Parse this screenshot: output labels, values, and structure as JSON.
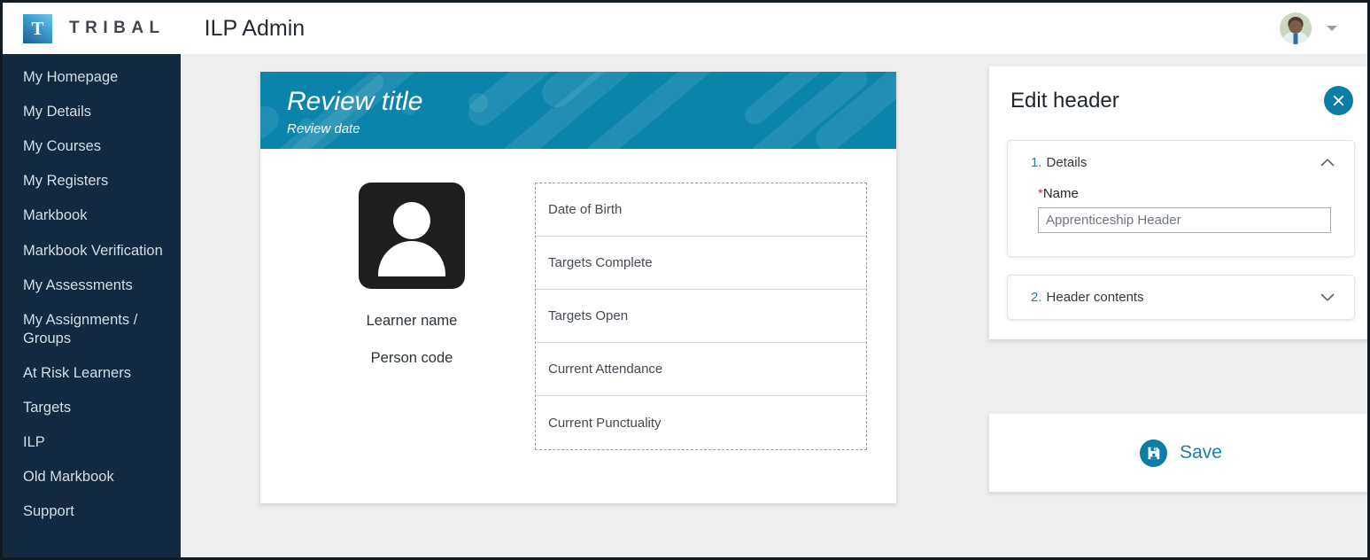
{
  "brand": {
    "logo_letter": "T",
    "logo_word": "TRIBAL",
    "app_title": "ILP Admin",
    "accent_color": "#0b7da6",
    "sidebar_color": "#13293f",
    "banner_color": "#0b84ac"
  },
  "topbar": {
    "avatar_name": "user-avatar",
    "caret_icon": "chevron-down-icon"
  },
  "sidebar": {
    "items": [
      {
        "label": "My Homepage"
      },
      {
        "label": "My Details"
      },
      {
        "label": "My Courses"
      },
      {
        "label": "My Registers"
      },
      {
        "label": "Markbook"
      },
      {
        "label": "Markbook Verification"
      },
      {
        "label": "My Assessments"
      },
      {
        "label": "My Assignments /\nGroups"
      },
      {
        "label": "At Risk Learners"
      },
      {
        "label": "Targets"
      },
      {
        "label": "ILP"
      },
      {
        "label": "Old Markbook"
      },
      {
        "label": "Support"
      }
    ]
  },
  "review_card": {
    "banner_title": "Review title",
    "banner_subtitle": "Review date",
    "learner": {
      "icon": "person-icon",
      "name_placeholder": "Learner name",
      "code_placeholder": "Person code"
    },
    "fields": [
      {
        "label": "Date of Birth"
      },
      {
        "label": "Targets Complete"
      },
      {
        "label": "Targets Open"
      },
      {
        "label": "Current Attendance"
      },
      {
        "label": "Current Punctuality"
      }
    ]
  },
  "edit_panel": {
    "title": "Edit header",
    "close_icon": "close-icon",
    "sections": [
      {
        "number": "1.",
        "label": "Details",
        "expanded": true,
        "chevron": "chevron-up-icon",
        "name_field": {
          "required_mark": "*",
          "label": "Name",
          "value": "Apprenticeship Header",
          "placeholder": "Apprenticeship Header"
        }
      },
      {
        "number": "2.",
        "label": "Header contents",
        "expanded": false,
        "chevron": "chevron-down-icon"
      }
    ],
    "save": {
      "label": "Save",
      "icon": "save-floppy-icon"
    }
  }
}
